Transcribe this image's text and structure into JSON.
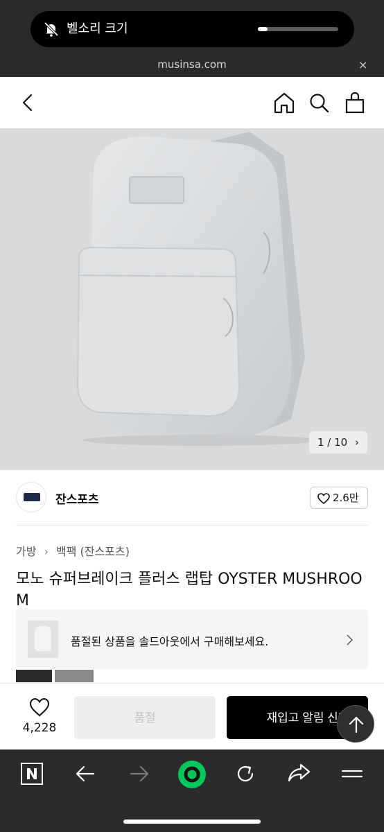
{
  "status": {
    "volume_label": "벨소리 크기",
    "volume_level": 0.12,
    "url": "musinsa.com",
    "close_symbol": "×"
  },
  "header": {
    "icons": [
      "back-icon",
      "home-icon",
      "search-icon",
      "cart-icon"
    ]
  },
  "product": {
    "image_pager": "1 / 10",
    "pager_chevron": "›",
    "brand_name": "잔스포츠",
    "like_count": "2.6만",
    "breadcrumb": [
      "가방",
      "백팩 (잔스포츠)"
    ],
    "breadcrumb_sep": "›",
    "title": "모노 슈퍼브레이크 플러스 랩탑 OYSTER MUSHROOM",
    "soldout_notice": "품절된 상품을 솔드아웃에서 구매해보세요."
  },
  "action_bar": {
    "wish_count": "4,228",
    "soldout_button": "품절",
    "restock_button": "재입고 알림 신청"
  },
  "browser_toolbar": {
    "icons": [
      "naver-n-icon",
      "back-arrow-icon",
      "forward-arrow-icon",
      "green-record-icon",
      "reload-icon",
      "share-icon",
      "menu-icon"
    ]
  },
  "colors": {
    "dark_bg": "#2b2b2d",
    "green": "#03c75a",
    "hero_bg": "#d9dadb"
  }
}
